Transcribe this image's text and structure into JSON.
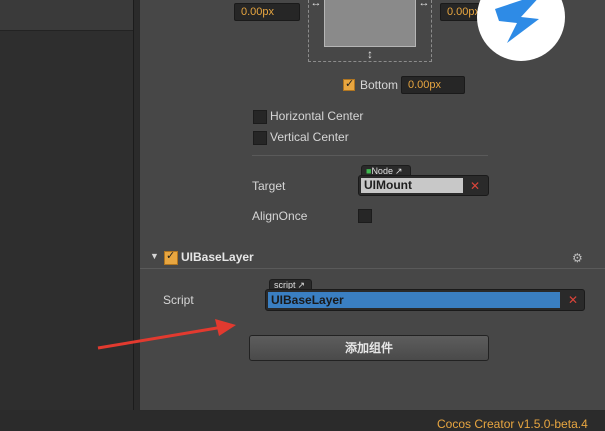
{
  "margins": {
    "left_value": "0.00px",
    "right_value": "0.00px",
    "bottom_label": "Bottom",
    "bottom_value": "0.00px",
    "bottom_checked": true
  },
  "alignment": {
    "horizontal_center": "Horizontal Center",
    "vertical_center": "Vertical Center"
  },
  "target": {
    "label": "Target",
    "tag": "Node",
    "value": "UIMount"
  },
  "align_once": {
    "label": "AlignOnce",
    "checked": false
  },
  "component": {
    "name": "UIBaseLayer",
    "enabled": true,
    "script_label": "Script",
    "script_tag": "script",
    "script_value": "UIBaseLayer"
  },
  "add_component_label": "添加组件",
  "footer_version": "Cocos Creator v1.5.0-beta.4",
  "colors": {
    "accent": "#e8a640",
    "selection": "#3a7fc2",
    "arrow": "#e23a2f"
  }
}
